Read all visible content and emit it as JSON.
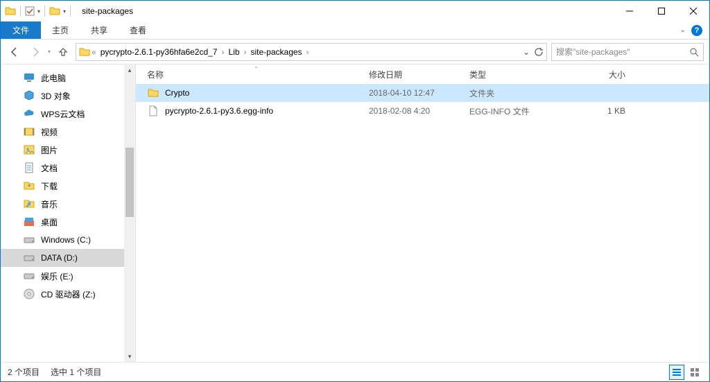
{
  "window": {
    "title": "site-packages"
  },
  "ribbon": {
    "file": "文件",
    "tabs": [
      "主页",
      "共享",
      "查看"
    ]
  },
  "nav": {
    "breadcrumbs": [
      "pycrypto-2.6.1-py36hfa6e2cd_7",
      "Lib",
      "site-packages"
    ]
  },
  "search": {
    "placeholder": "搜索\"site-packages\""
  },
  "sidebar": {
    "items": [
      {
        "label": "此电脑",
        "icon": "pc"
      },
      {
        "label": "3D 对象",
        "icon": "3d"
      },
      {
        "label": "WPS云文档",
        "icon": "cloud"
      },
      {
        "label": "视频",
        "icon": "video"
      },
      {
        "label": "图片",
        "icon": "image"
      },
      {
        "label": "文档",
        "icon": "doc"
      },
      {
        "label": "下载",
        "icon": "dl"
      },
      {
        "label": "音乐",
        "icon": "music"
      },
      {
        "label": "桌面",
        "icon": "desk"
      },
      {
        "label": "Windows (C:)",
        "icon": "drive"
      },
      {
        "label": "DATA (D:)",
        "icon": "drive",
        "selected": true
      },
      {
        "label": "娱乐 (E:)",
        "icon": "drive"
      },
      {
        "label": "CD 驱动器 (Z:)",
        "icon": "cd"
      }
    ]
  },
  "columns": {
    "name": "名称",
    "date": "修改日期",
    "type": "类型",
    "size": "大小"
  },
  "files": [
    {
      "name": "Crypto",
      "date": "2018-04-10 12:47",
      "type": "文件夹",
      "size": "",
      "icon": "folder",
      "selected": true
    },
    {
      "name": "pycrypto-2.6.1-py3.6.egg-info",
      "date": "2018-02-08 4:20",
      "type": "EGG-INFO 文件",
      "size": "1 KB",
      "icon": "file"
    }
  ],
  "status": {
    "count": "2 个项目",
    "selected": "选中 1 个项目"
  }
}
